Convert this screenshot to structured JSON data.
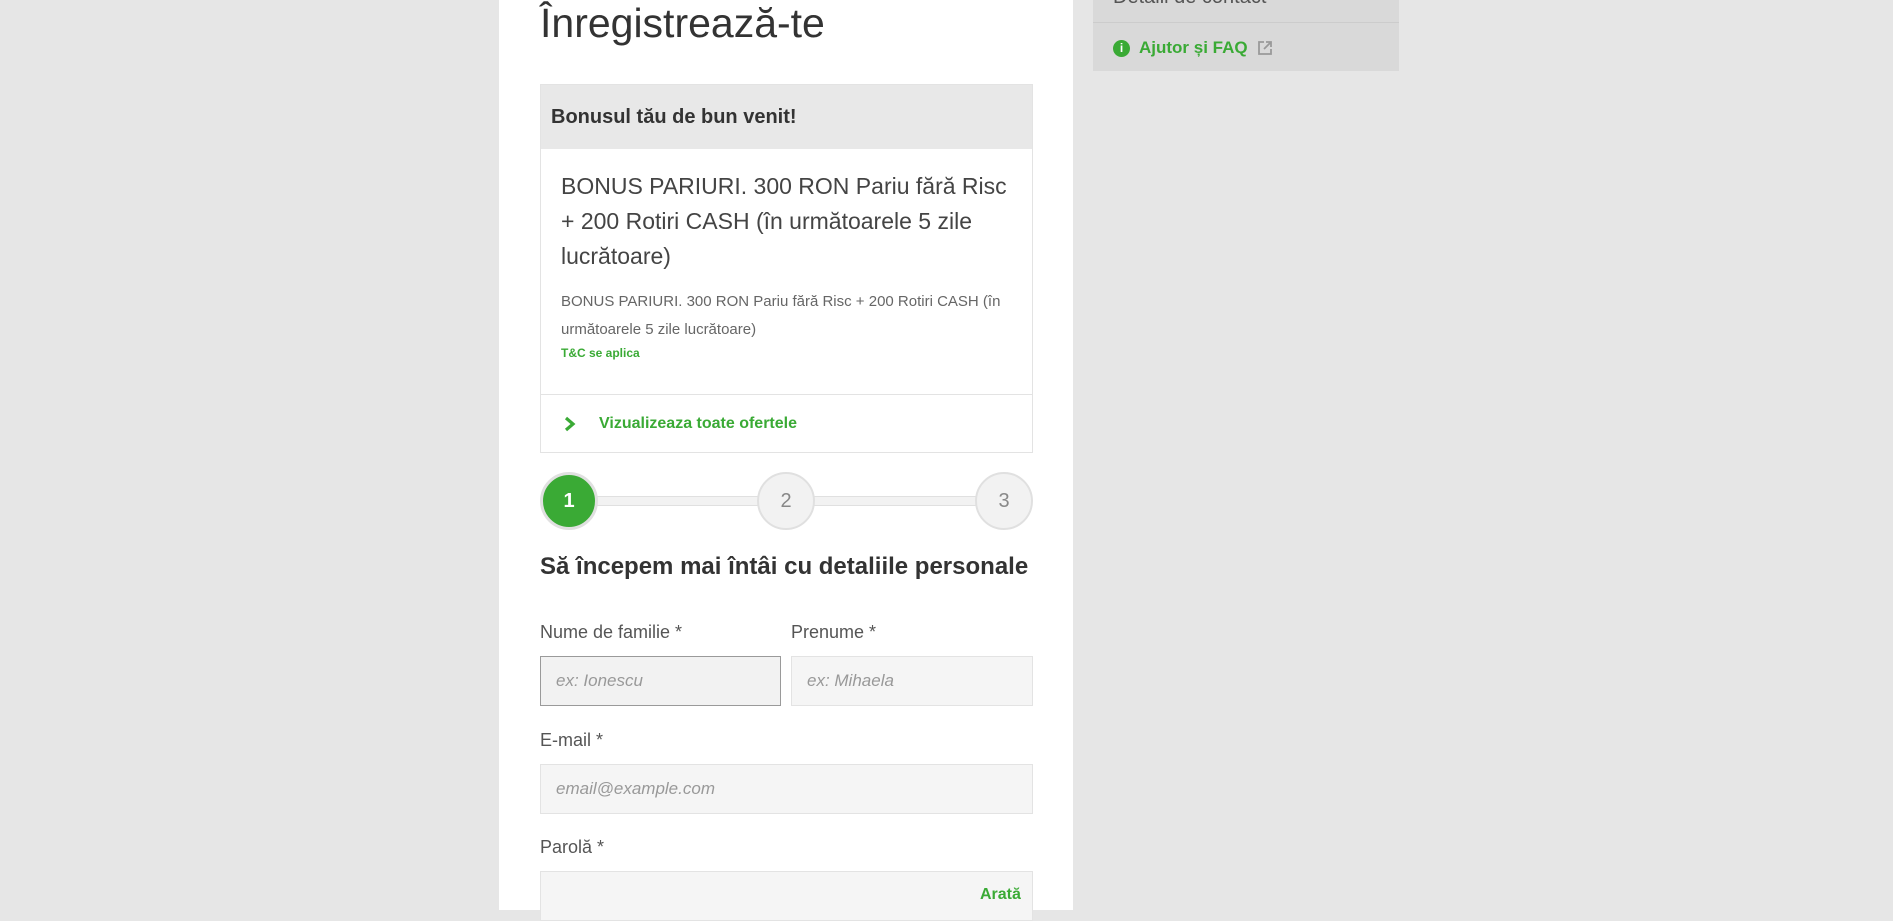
{
  "page": {
    "title": "Înregistrează-te"
  },
  "bonus": {
    "header": "Bonusul tău de bun venit!",
    "main_text": "BONUS PARIURI. 300 RON Pariu fără Risc + 200 Rotiri CASH (în următoarele 5 zile lucrătoare)",
    "description": "BONUS PARIURI. 300 RON Pariu fără Risc + 200 Rotiri CASH (în următoarele 5 zile lucrătoare)",
    "tc_link": "T&C se aplica",
    "view_all_label": "Vizualizeaza toate ofertele"
  },
  "stepper": {
    "steps": [
      "1",
      "2",
      "3"
    ],
    "active_step": 1
  },
  "form": {
    "section_title": "Să începem mai întâi cu detaliile personale",
    "last_name": {
      "label": "Nume de familie *",
      "placeholder": "ex: Ionescu",
      "value": ""
    },
    "first_name": {
      "label": "Prenume *",
      "placeholder": "ex: Mihaela",
      "value": ""
    },
    "email": {
      "label": "E-mail *",
      "placeholder": "email@example.com",
      "value": ""
    },
    "password": {
      "label": "Parolă *",
      "placeholder": "",
      "value": "",
      "show_label": "Arată"
    }
  },
  "sidebar": {
    "top_item": "Detalii de contact",
    "help_link": "Ajutor și FAQ"
  },
  "colors": {
    "accent": "#3aaa35",
    "background": "#e6e6e6",
    "card": "#ffffff"
  }
}
